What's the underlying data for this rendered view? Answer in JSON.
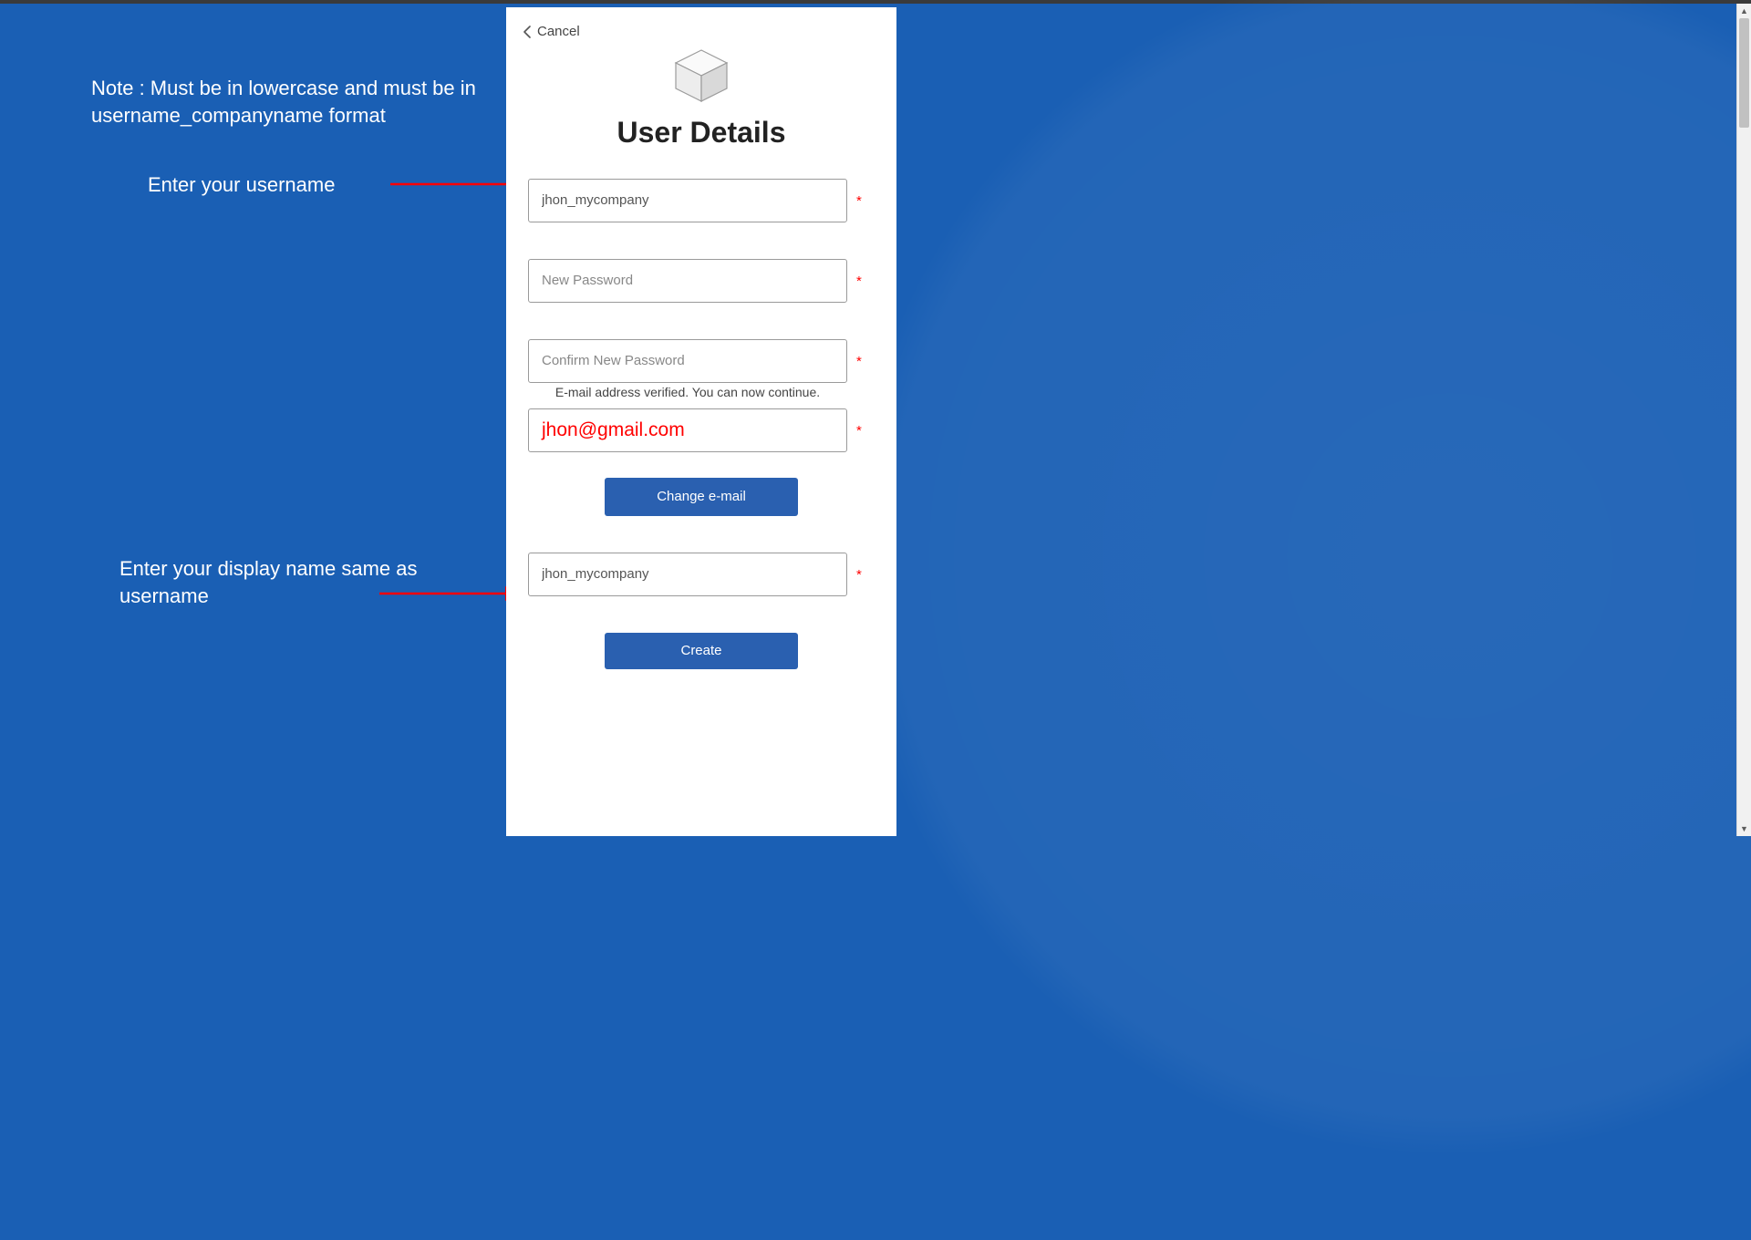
{
  "cancel_label": "Cancel",
  "heading": "User Details",
  "form": {
    "username": {
      "value": "jhon_mycompany",
      "required": "*"
    },
    "password": {
      "placeholder": "New Password",
      "required": "*"
    },
    "confirm": {
      "placeholder": "Confirm New Password",
      "required": "*"
    },
    "email_status": "E-mail address verified. You can now continue.",
    "email": {
      "value": "jhon@gmail.com",
      "required": "*"
    },
    "change_email_label": "Change e-mail",
    "display_name": {
      "value": "jhon_mycompany",
      "required": "*"
    },
    "create_label": "Create"
  },
  "annotations": {
    "note": "Note : Must be in lowercase and must be in username_companyname format",
    "username_hint": "Enter your username",
    "display_hint": "Enter your display name same as username"
  }
}
